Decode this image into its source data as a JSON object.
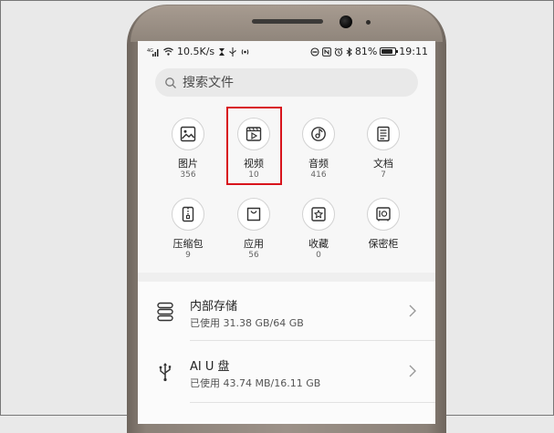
{
  "status_bar": {
    "network_speed": "10.5K/s",
    "battery_percent": "81%",
    "battery_level": 0.81,
    "time": "19:11"
  },
  "search": {
    "placeholder": "搜索文件"
  },
  "categories": [
    {
      "label": "图片",
      "count": "356",
      "icon": "image-icon"
    },
    {
      "label": "视频",
      "count": "10",
      "icon": "video-icon"
    },
    {
      "label": "音频",
      "count": "416",
      "icon": "audio-icon"
    },
    {
      "label": "文档",
      "count": "7",
      "icon": "document-icon"
    },
    {
      "label": "压缩包",
      "count": "9",
      "icon": "archive-icon"
    },
    {
      "label": "应用",
      "count": "56",
      "icon": "app-bag-icon"
    },
    {
      "label": "收藏",
      "count": "0",
      "icon": "favorite-star-icon"
    },
    {
      "label": "保密柜",
      "count": "",
      "icon": "safe-icon"
    }
  ],
  "storage": [
    {
      "title": "内部存储",
      "subtitle": "已使用 31.38 GB/64 GB",
      "icon": "storage-icon"
    },
    {
      "title": "AI U 盘",
      "subtitle": "已使用 43.74 MB/16.11 GB",
      "icon": "usb-icon"
    }
  ],
  "colors": {
    "highlight": "#d8141c",
    "phone_frame": "#9c9188",
    "screen_bg": "#f7f7f7",
    "icon_stroke": "#333333"
  }
}
